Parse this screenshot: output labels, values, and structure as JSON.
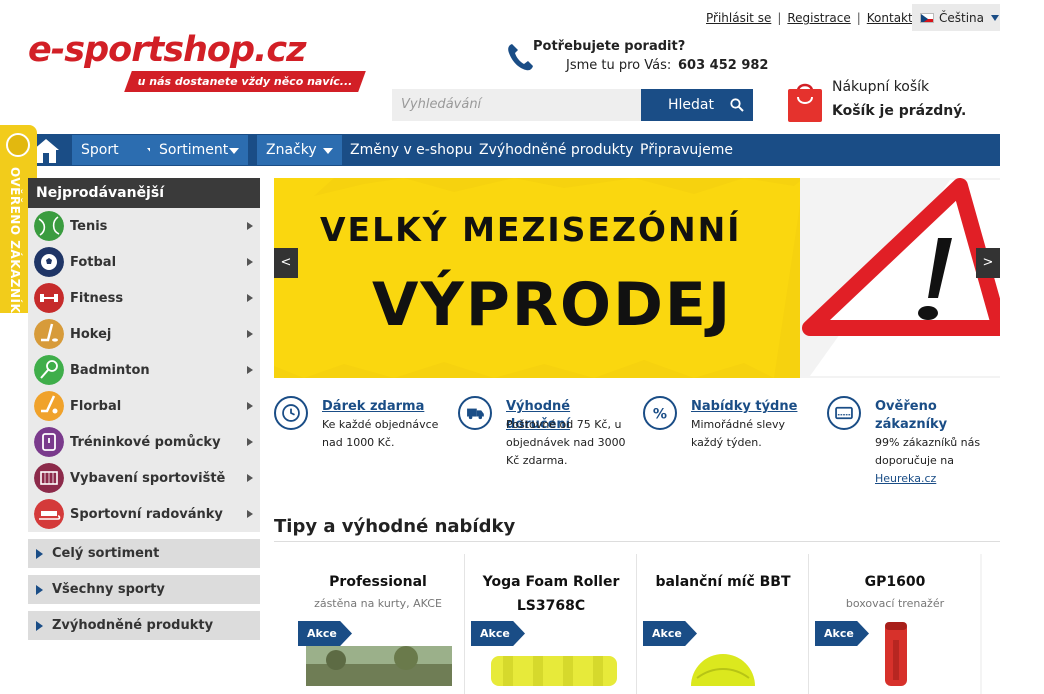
{
  "header": {
    "login": "Přihlásit se",
    "register": "Registrace",
    "contact": "Kontakt",
    "language": "Čeština",
    "logo": "e-sportshop.cz",
    "slogan": "u nás dostanete vždy něco navíc...",
    "phone_question": "Potřebujete poradit?",
    "phone_label": "Jsme tu pro Vás:",
    "phone_number": "603 452 982",
    "search_placeholder": "Vyhledávání",
    "search_button": "Hledat",
    "cart_title": "Nákupní košík",
    "cart_state": "Košík je prázdný."
  },
  "nav": {
    "items": [
      "Sport",
      "Sortiment",
      "Značky",
      "Změny v e-shopu",
      "Zvýhodněné produkty",
      "Připravujeme"
    ]
  },
  "badge": {
    "label": "OVĚŘENO ZÁKAZNÍKY"
  },
  "sidebar": {
    "heading": "Nejprodávanější",
    "items": [
      {
        "label": "Tenis",
        "icon": "tennis-icon"
      },
      {
        "label": "Fotbal",
        "icon": "football-icon"
      },
      {
        "label": "Fitness",
        "icon": "dumbbell-icon"
      },
      {
        "label": "Hokej",
        "icon": "hockey-icon"
      },
      {
        "label": "Badminton",
        "icon": "badminton-icon"
      },
      {
        "label": "Florbal",
        "icon": "floorball-icon"
      },
      {
        "label": "Tréninkové pomůcky",
        "icon": "stopwatch-icon"
      },
      {
        "label": "Vybavení sportoviště",
        "icon": "goal-icon"
      },
      {
        "label": "Sportovní radovánky",
        "icon": "sled-icon"
      }
    ],
    "links": [
      "Celý sortiment",
      "Všechny sporty",
      "Zvýhodněné produkty"
    ]
  },
  "banner": {
    "line1": "VELKÝ MEZISEZÓNNÍ",
    "line2": "VÝPRODEJ",
    "prev": "<",
    "next": ">"
  },
  "features": [
    {
      "title": "Dárek zdarma",
      "lines": [
        "Ke každé objednávce",
        "nad 1000 Kč."
      ],
      "icon": "clock-icon"
    },
    {
      "title": "Výhodné doručení",
      "lines": [
        "Poštovné od 75 Kč, u",
        "objednávek nad 3000",
        "Kč zdarma."
      ],
      "icon": "truck-icon"
    },
    {
      "title": "Nabídky týdne",
      "lines": [
        "Mimořádné slevy",
        "každý týden."
      ],
      "icon": "percent-icon"
    },
    {
      "title": "Ověřeno zákazníky",
      "lines": [
        "99% zákazníků nás",
        "doporučuje na"
      ],
      "link": "Heureka.cz",
      "icon": "card-icon"
    }
  ],
  "tips": {
    "title": "Tipy a výhodné nabídky",
    "products": [
      {
        "name": "Professional",
        "sub": "zástěna na kurty, AKCE",
        "tag": "Akce"
      },
      {
        "name": "Yoga Foam Roller LS3768C",
        "sub": "",
        "tag": "Akce"
      },
      {
        "name": "balanční míč BBT",
        "sub": "",
        "tag": "Akce"
      },
      {
        "name": "GP1600",
        "sub": "boxovací trenažér",
        "tag": "Akce"
      }
    ]
  },
  "colors": {
    "brand_red": "#d21f26",
    "brand_blue": "#1a4d86",
    "banner_yellow": "#f6d20f"
  }
}
